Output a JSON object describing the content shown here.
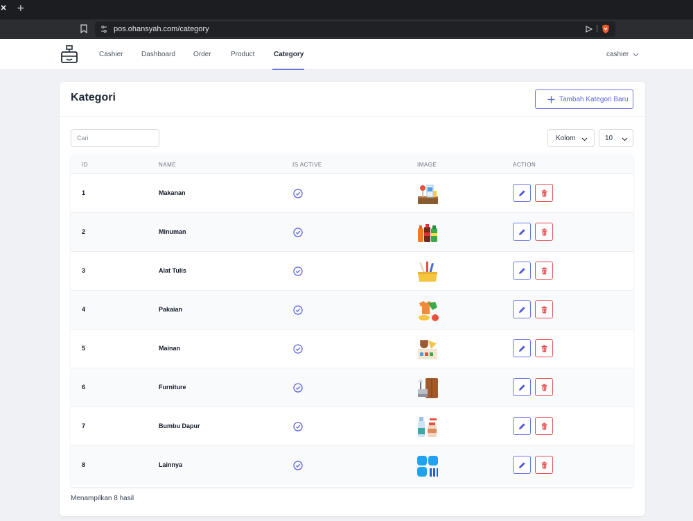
{
  "browser": {
    "url": "pos.ohansyah.com/category",
    "tab_close": "×",
    "new_tab": "+"
  },
  "nav": {
    "items": [
      {
        "label": "Cashier",
        "active": false
      },
      {
        "label": "Dashboard",
        "active": false
      },
      {
        "label": "Order",
        "active": false
      },
      {
        "label": "Product",
        "active": false
      },
      {
        "label": "Category",
        "active": true
      }
    ],
    "user": "cashier"
  },
  "page": {
    "title": "Kategori",
    "add_button": "Tambah Kategori Baru",
    "search_placeholder": "Cari",
    "columns_button": "Kolom",
    "page_size": "10",
    "footer": "Menampilkan 8 hasil"
  },
  "table": {
    "headers": [
      "ID",
      "NAME",
      "IS ACTIVE",
      "IMAGE",
      "ACTION"
    ],
    "rows": [
      {
        "id": "1",
        "name": "Makanan",
        "active": true,
        "image": "food-image"
      },
      {
        "id": "2",
        "name": "Minuman",
        "active": true,
        "image": "drinks-image"
      },
      {
        "id": "3",
        "name": "Alat Tulis",
        "active": true,
        "image": "stationery-image"
      },
      {
        "id": "4",
        "name": "Pakaian",
        "active": true,
        "image": "clothing-image"
      },
      {
        "id": "5",
        "name": "Mainan",
        "active": true,
        "image": "toys-image"
      },
      {
        "id": "6",
        "name": "Furniture",
        "active": true,
        "image": "furniture-image"
      },
      {
        "id": "7",
        "name": "Bumbu Dapur",
        "active": true,
        "image": "spices-image"
      },
      {
        "id": "8",
        "name": "Lainnya",
        "active": true,
        "image": "others-image"
      }
    ]
  },
  "colors": {
    "accent": "#6b74e3",
    "danger": "#e05252",
    "chrome_dark": "#1c1d21"
  }
}
